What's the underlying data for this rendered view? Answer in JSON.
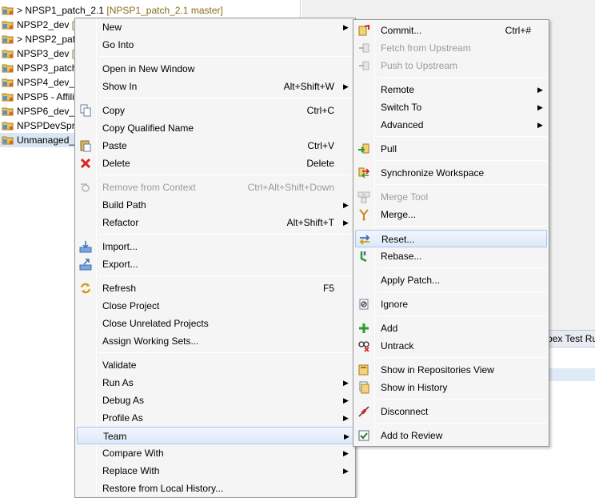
{
  "tree": {
    "rows": [
      {
        "label": "> NPSP1_patch_2.1",
        "deco": " [NPSP1_patch_2.1 master]",
        "selected": false
      },
      {
        "label": "NPSP2_dev",
        "deco": " [N",
        "selected": false
      },
      {
        "label": "> NPSP2_patc",
        "deco": "",
        "selected": false
      },
      {
        "label": "NPSP3_dev",
        "deco": " [N",
        "selected": false
      },
      {
        "label": "NPSP3_patch_",
        "deco": "",
        "selected": false
      },
      {
        "label": "NPSP4_dev_1.",
        "deco": "",
        "selected": false
      },
      {
        "label": "NPSP5 - Affili",
        "deco": "",
        "selected": false
      },
      {
        "label": "NPSP6_dev_1.",
        "deco": "",
        "selected": false
      },
      {
        "label": "NPSPDevSprir",
        "deco": "",
        "selected": false
      },
      {
        "label": "Unmanaged_",
        "deco": "",
        "selected": true
      }
    ]
  },
  "right_pane": {
    "tab_label": "pex Test Ru"
  },
  "context_menu": {
    "items": [
      {
        "label": "New",
        "shortcut": "",
        "submenu": true,
        "icon": "",
        "disabled": false
      },
      {
        "label": "Go Into",
        "shortcut": "",
        "submenu": false,
        "icon": "",
        "disabled": false
      },
      {
        "sep": true
      },
      {
        "label": "Open in New Window",
        "shortcut": "",
        "submenu": false,
        "icon": "",
        "disabled": false
      },
      {
        "label": "Show In",
        "shortcut": "Alt+Shift+W",
        "submenu": true,
        "icon": "",
        "disabled": false
      },
      {
        "sep": true
      },
      {
        "label": "Copy",
        "shortcut": "Ctrl+C",
        "submenu": false,
        "icon": "copy-icon",
        "disabled": false
      },
      {
        "label": "Copy Qualified Name",
        "shortcut": "",
        "submenu": false,
        "icon": "",
        "disabled": false
      },
      {
        "label": "Paste",
        "shortcut": "Ctrl+V",
        "submenu": false,
        "icon": "paste-icon",
        "disabled": false
      },
      {
        "label": "Delete",
        "shortcut": "Delete",
        "submenu": false,
        "icon": "delete-icon",
        "disabled": false
      },
      {
        "sep": true
      },
      {
        "label": "Remove from Context",
        "shortcut": "Ctrl+Alt+Shift+Down",
        "submenu": false,
        "icon": "remove-context-icon",
        "disabled": true
      },
      {
        "label": "Build Path",
        "shortcut": "",
        "submenu": true,
        "icon": "",
        "disabled": false
      },
      {
        "label": "Refactor",
        "shortcut": "Alt+Shift+T",
        "submenu": true,
        "icon": "",
        "disabled": false
      },
      {
        "sep": true
      },
      {
        "label": "Import...",
        "shortcut": "",
        "submenu": false,
        "icon": "import-icon",
        "disabled": false
      },
      {
        "label": "Export...",
        "shortcut": "",
        "submenu": false,
        "icon": "export-icon",
        "disabled": false
      },
      {
        "sep": true
      },
      {
        "label": "Refresh",
        "shortcut": "F5",
        "submenu": false,
        "icon": "refresh-icon",
        "disabled": false
      },
      {
        "label": "Close Project",
        "shortcut": "",
        "submenu": false,
        "icon": "",
        "disabled": false
      },
      {
        "label": "Close Unrelated Projects",
        "shortcut": "",
        "submenu": false,
        "icon": "",
        "disabled": false
      },
      {
        "label": "Assign Working Sets...",
        "shortcut": "",
        "submenu": false,
        "icon": "",
        "disabled": false
      },
      {
        "sep": true
      },
      {
        "label": "Validate",
        "shortcut": "",
        "submenu": false,
        "icon": "",
        "disabled": false
      },
      {
        "label": "Run As",
        "shortcut": "",
        "submenu": true,
        "icon": "",
        "disabled": false
      },
      {
        "label": "Debug As",
        "shortcut": "",
        "submenu": true,
        "icon": "",
        "disabled": false
      },
      {
        "label": "Profile As",
        "shortcut": "",
        "submenu": true,
        "icon": "",
        "disabled": false
      },
      {
        "label": "Team",
        "shortcut": "",
        "submenu": true,
        "icon": "",
        "disabled": false,
        "hover": true
      },
      {
        "label": "Compare With",
        "shortcut": "",
        "submenu": true,
        "icon": "",
        "disabled": false
      },
      {
        "label": "Replace With",
        "shortcut": "",
        "submenu": true,
        "icon": "",
        "disabled": false
      },
      {
        "label": "Restore from Local History...",
        "shortcut": "",
        "submenu": false,
        "icon": "",
        "disabled": false
      }
    ]
  },
  "team_menu": {
    "items": [
      {
        "label": "Commit...",
        "shortcut": "Ctrl+#",
        "submenu": false,
        "icon": "commit-icon",
        "disabled": false
      },
      {
        "label": "Fetch from Upstream",
        "shortcut": "",
        "submenu": false,
        "icon": "fetch-icon",
        "disabled": true
      },
      {
        "label": "Push to Upstream",
        "shortcut": "",
        "submenu": false,
        "icon": "push-icon",
        "disabled": true
      },
      {
        "sep": true
      },
      {
        "label": "Remote",
        "shortcut": "",
        "submenu": true,
        "icon": "",
        "disabled": false
      },
      {
        "label": "Switch To",
        "shortcut": "",
        "submenu": true,
        "icon": "",
        "disabled": false
      },
      {
        "label": "Advanced",
        "shortcut": "",
        "submenu": true,
        "icon": "",
        "disabled": false
      },
      {
        "sep": true
      },
      {
        "label": "Pull",
        "shortcut": "",
        "submenu": false,
        "icon": "pull-icon",
        "disabled": false
      },
      {
        "sep": true
      },
      {
        "label": "Synchronize Workspace",
        "shortcut": "",
        "submenu": false,
        "icon": "synchronize-icon",
        "disabled": false
      },
      {
        "sep": true
      },
      {
        "label": "Merge Tool",
        "shortcut": "",
        "submenu": false,
        "icon": "merge-tool-icon",
        "disabled": true
      },
      {
        "label": "Merge...",
        "shortcut": "",
        "submenu": false,
        "icon": "merge-icon",
        "disabled": false
      },
      {
        "sep": true
      },
      {
        "label": "Reset...",
        "shortcut": "",
        "submenu": false,
        "icon": "reset-icon",
        "disabled": false,
        "hover": true
      },
      {
        "label": "Rebase...",
        "shortcut": "",
        "submenu": false,
        "icon": "rebase-icon",
        "disabled": false
      },
      {
        "sep": true
      },
      {
        "label": "Apply Patch...",
        "shortcut": "",
        "submenu": false,
        "icon": "",
        "disabled": false
      },
      {
        "sep": true
      },
      {
        "label": "Ignore",
        "shortcut": "",
        "submenu": false,
        "icon": "ignore-icon",
        "disabled": false
      },
      {
        "sep": true
      },
      {
        "label": "Add",
        "shortcut": "",
        "submenu": false,
        "icon": "add-icon",
        "disabled": false
      },
      {
        "label": "Untrack",
        "shortcut": "",
        "submenu": false,
        "icon": "untrack-icon",
        "disabled": false
      },
      {
        "sep": true
      },
      {
        "label": "Show in Repositories View",
        "shortcut": "",
        "submenu": false,
        "icon": "repositories-icon",
        "disabled": false
      },
      {
        "label": "Show in History",
        "shortcut": "",
        "submenu": false,
        "icon": "history-icon",
        "disabled": false
      },
      {
        "sep": true
      },
      {
        "label": "Disconnect",
        "shortcut": "",
        "submenu": false,
        "icon": "disconnect-icon",
        "disabled": false
      },
      {
        "sep": true
      },
      {
        "label": "Add to Review",
        "shortcut": "",
        "submenu": false,
        "icon": "add-to-review-icon",
        "disabled": false
      }
    ]
  },
  "colors": {
    "menu_bg": "#f5f5f5",
    "hover_border": "#a8c8ee",
    "disabled_text": "#9a9a9a",
    "decoration": "#8a6a18"
  }
}
